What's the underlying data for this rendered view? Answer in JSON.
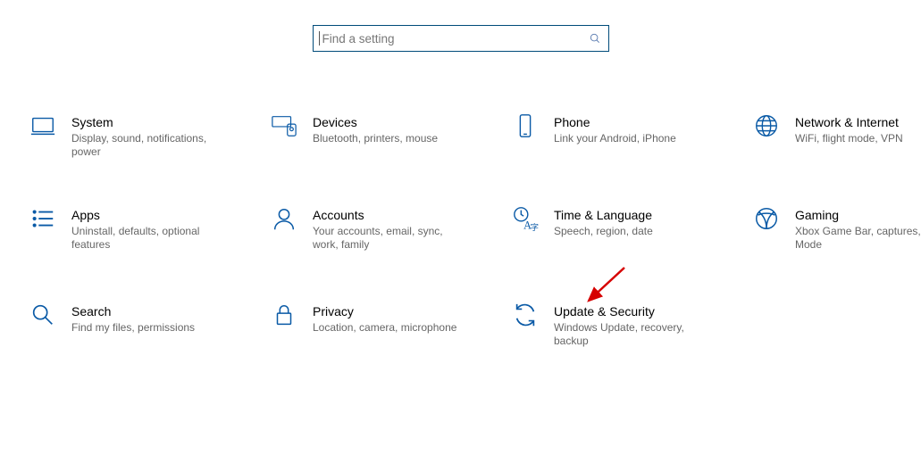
{
  "search": {
    "placeholder": "Find a setting"
  },
  "tiles": {
    "system": {
      "title": "System",
      "desc": "Display, sound, notifications, power"
    },
    "devices": {
      "title": "Devices",
      "desc": "Bluetooth, printers, mouse"
    },
    "phone": {
      "title": "Phone",
      "desc": "Link your Android, iPhone"
    },
    "network": {
      "title": "Network & Internet",
      "desc": "WiFi, flight mode, VPN"
    },
    "apps": {
      "title": "Apps",
      "desc": "Uninstall, defaults, optional features"
    },
    "accounts": {
      "title": "Accounts",
      "desc": "Your accounts, email, sync, work, family"
    },
    "timelang": {
      "title": "Time & Language",
      "desc": "Speech, region, date"
    },
    "gaming": {
      "title": "Gaming",
      "desc": "Xbox Game Bar, captures, Mode"
    },
    "search": {
      "title": "Search",
      "desc": "Find my files, permissions"
    },
    "privacy": {
      "title": "Privacy",
      "desc": "Location, camera, microphone"
    },
    "update": {
      "title": "Update & Security",
      "desc": "Windows Update, recovery, backup"
    }
  },
  "annotation": {
    "arrow_target": "update"
  }
}
